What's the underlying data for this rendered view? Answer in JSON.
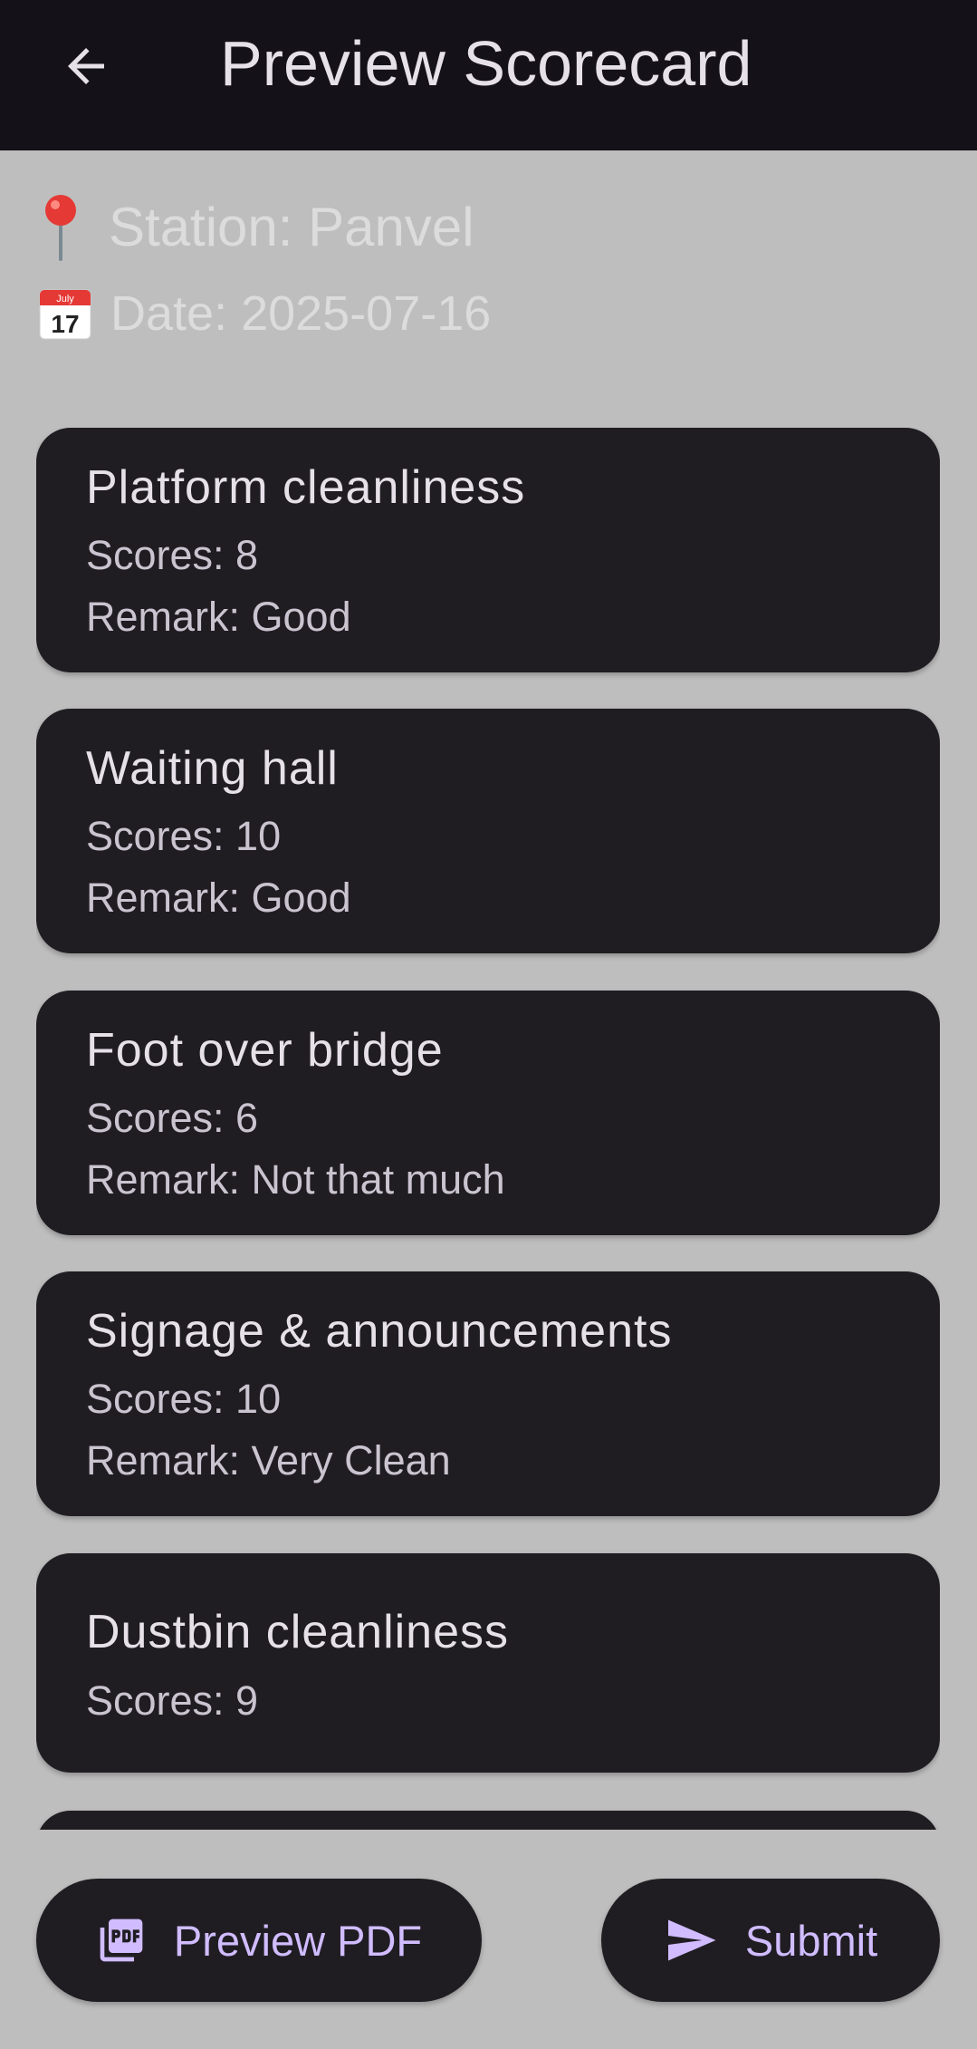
{
  "appbar": {
    "title": "Preview Scorecard",
    "back_icon": "arrow-back-icon"
  },
  "info": {
    "station_icon": "pin-icon",
    "station": "Station: Panvel",
    "date_icon": "calendar-icon",
    "calendar_month": "July",
    "calendar_day": "17",
    "date": "Date: 2025-07-16"
  },
  "cards": [
    {
      "title": "Platform cleanliness",
      "scores": "Scores: 8",
      "remark": "Remark: Good"
    },
    {
      "title": "Waiting hall",
      "scores": "Scores: 10",
      "remark": "Remark: Good"
    },
    {
      "title": "Foot over bridge",
      "scores": "Scores: 6",
      "remark": "Remark: Not that much"
    },
    {
      "title": "Signage & announcements",
      "scores": "Scores: 10",
      "remark": "Remark: Very Clean"
    },
    {
      "title": "Dustbin cleanliness",
      "scores": "Scores: 9"
    }
  ],
  "actions": {
    "preview_pdf_label": "Preview PDF",
    "preview_pdf_icon": "pdf-icon",
    "submit_label": "Submit",
    "submit_icon": "send-icon"
  },
  "colors": {
    "appbar_bg": "#141218",
    "page_bg": "#bebebe",
    "card_bg": "#1f1d22",
    "accent": "#d0bcff"
  }
}
